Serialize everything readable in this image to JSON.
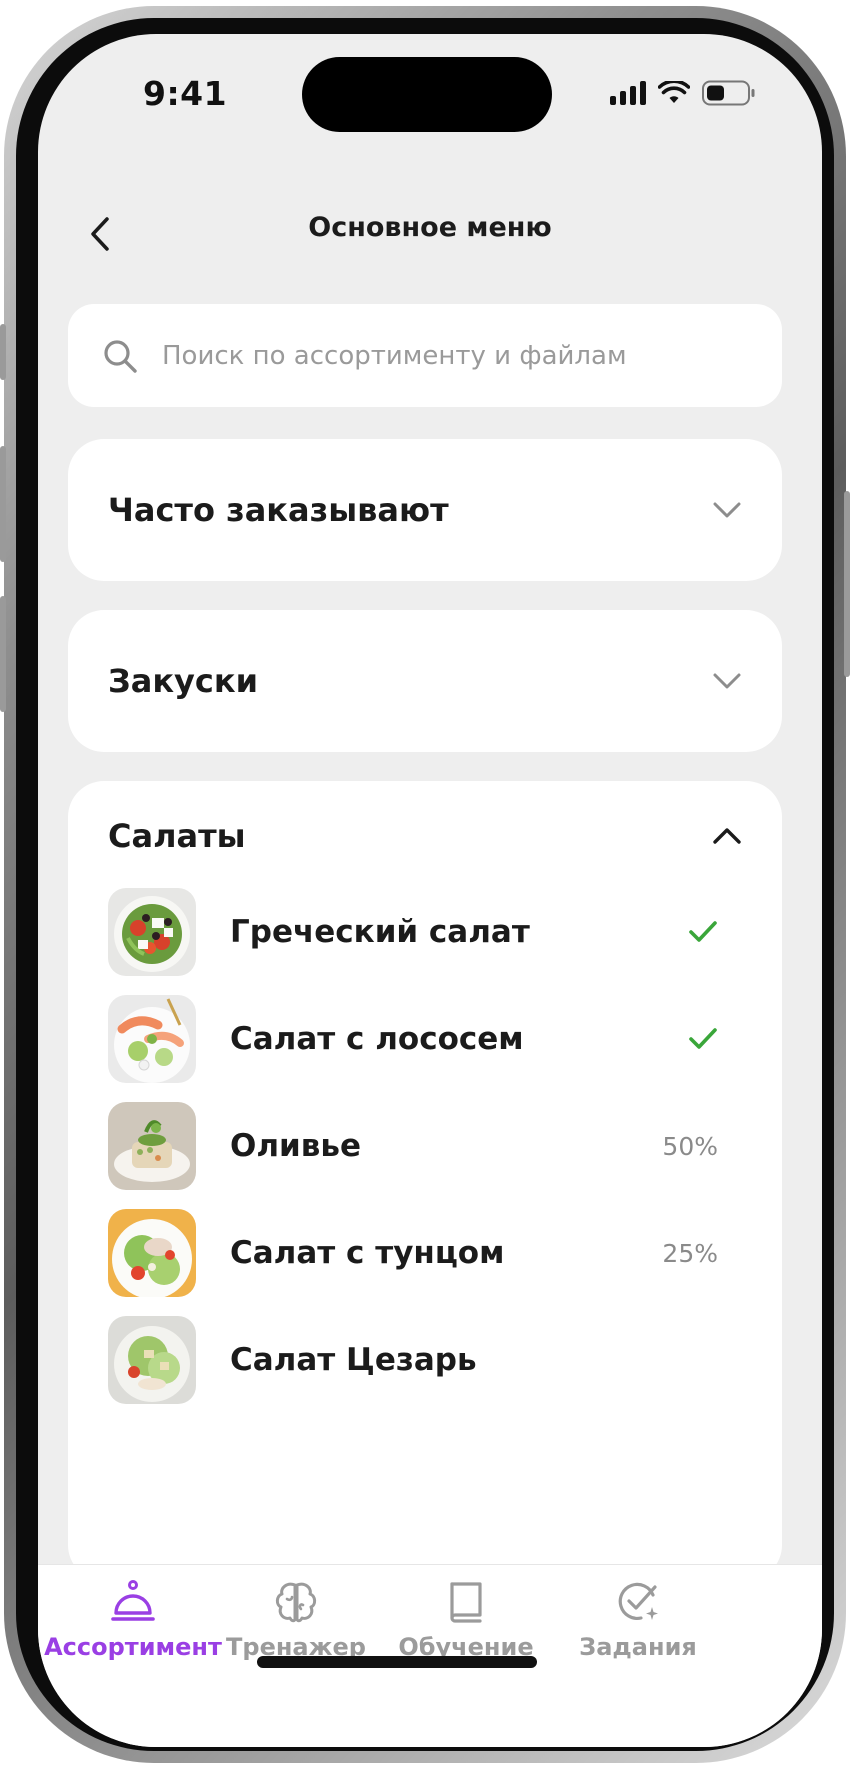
{
  "status_bar": {
    "time": "9:41",
    "icons": [
      "signal-icon",
      "wifi-icon",
      "battery-icon"
    ]
  },
  "header": {
    "back_icon": "chevron-left-icon",
    "title": "Основное меню"
  },
  "search": {
    "icon": "search-icon",
    "placeholder": "Поиск по ассортименту и файлам",
    "value": ""
  },
  "sections": [
    {
      "title": "Часто заказывают",
      "expanded": false,
      "icon": "chevron-down-icon"
    },
    {
      "title": "Закуски",
      "expanded": false,
      "icon": "chevron-down-icon"
    },
    {
      "title": "Салаты",
      "expanded": true,
      "icon": "chevron-up-icon",
      "items": [
        {
          "label": "Греческий салат",
          "status": "done",
          "progress": ""
        },
        {
          "label": "Салат с лососем",
          "status": "done",
          "progress": ""
        },
        {
          "label": "Оливье",
          "status": "progress",
          "progress": "50%"
        },
        {
          "label": "Салат с тунцом",
          "status": "progress",
          "progress": "25%"
        },
        {
          "label": "Салат Цезарь",
          "status": "none",
          "progress": ""
        }
      ]
    }
  ],
  "tabbar": {
    "tabs": [
      {
        "label": "Ассортимент",
        "icon": "service-bell-icon",
        "active": true
      },
      {
        "label": "Тренажер",
        "icon": "brain-icon",
        "active": false
      },
      {
        "label": "Обучение",
        "icon": "book-icon",
        "active": false
      },
      {
        "label": "Задания",
        "icon": "task-check-icon",
        "active": false
      }
    ]
  },
  "colors": {
    "accent": "#9a3fe4",
    "check": "#3aa63a",
    "background": "#eeeeee",
    "card": "#ffffff"
  }
}
